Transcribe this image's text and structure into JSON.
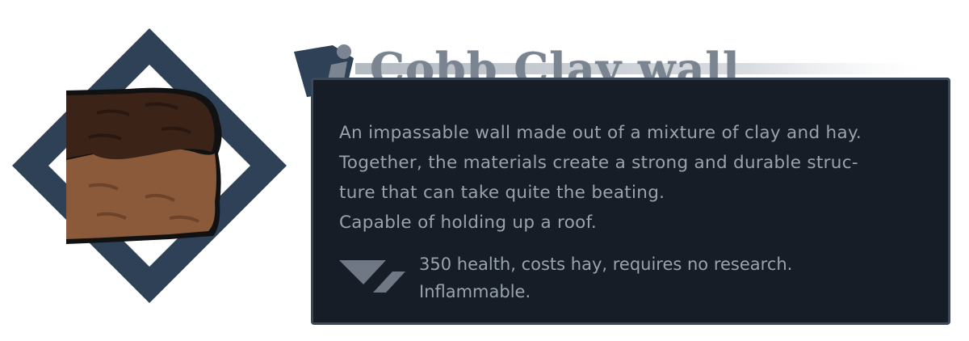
{
  "item": {
    "title": "Cobb Clay wall",
    "icon": "clay-wall-block-icon",
    "description": [
      "An impassable wall made out of a mixture of clay and hay.",
      "Together, the materials create a strong and durable struc-",
      "ture that can take quite the beating.",
      "Capable of holding up a roof."
    ],
    "stats_icon": "chevron-down-icon",
    "stats": [
      "350 health, costs hay, requires no research.",
      "Inflammable."
    ]
  },
  "colors": {
    "panel_bg": "#161d27",
    "panel_border": "#3a4858",
    "frame": "#2e4157",
    "text": "#9aa3ad",
    "title": "#7a8591"
  }
}
